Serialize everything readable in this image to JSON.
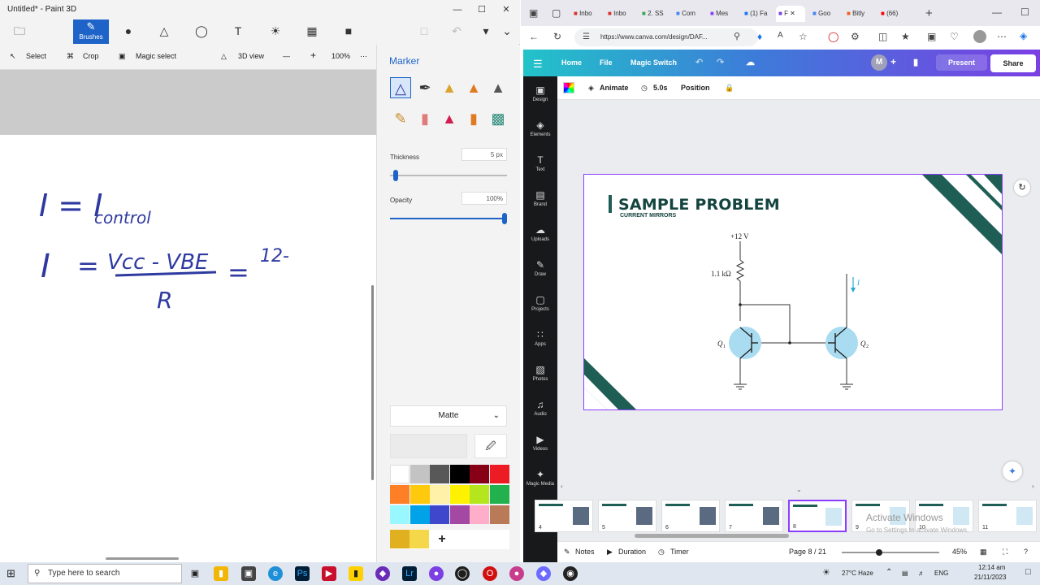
{
  "paint3d": {
    "title": "Untitled* - Paint 3D",
    "ribbon": {
      "brushes_label": "Brushes"
    },
    "toolbar": {
      "select": "Select",
      "crop": "Crop",
      "magic_select": "Magic select",
      "view3d": "3D view",
      "zoom": "100%"
    },
    "panel": {
      "title": "Marker",
      "thickness_label": "Thickness",
      "thickness_value": "5 px",
      "thickness_fraction": 0.05,
      "opacity_label": "Opacity",
      "opacity_value": "100%",
      "opacity_fraction": 1.0,
      "finish": "Matte",
      "add_color": "+",
      "palette": [
        "#ffffff",
        "#c3c3c3",
        "#585858",
        "#000000",
        "#880015",
        "#ed1c24",
        "#ff7f27",
        "#ffc90e",
        "#fff2a8",
        "#fff200",
        "#b5e61d",
        "#22b14c",
        "#99f7ff",
        "#00a2e8",
        "#3f48cc",
        "#a349a4",
        "#ffaec9",
        "#b97a57"
      ],
      "custom_colors": [
        "#e0b020",
        "#f5d84a"
      ]
    },
    "handwriting": {
      "line1a": "I = I",
      "line1b": "control",
      "line2a": "I",
      "line2b": "=",
      "numerator": "Vcc - VBE",
      "denominator": "R",
      "line2c": "=",
      "line2d": "12-"
    }
  },
  "browser": {
    "tabs": [
      "Inbo",
      "Inbo",
      "2. SS",
      "Com",
      "Mes",
      "(1) Fa",
      "F",
      "Goo",
      "Bitly",
      "(66)"
    ],
    "url": "https://www.canva.com/design/DAF...",
    "new_tab": "+"
  },
  "canva": {
    "nav": {
      "home": "Home",
      "file": "File",
      "magic_switch": "Magic Switch",
      "avatar": "M",
      "present": "Present",
      "share": "Share"
    },
    "sidebar": [
      {
        "icon": "▣",
        "label": "Design"
      },
      {
        "icon": "◈",
        "label": "Elements"
      },
      {
        "icon": "T",
        "label": "Text"
      },
      {
        "icon": "▤",
        "label": "Brand"
      },
      {
        "icon": "☁",
        "label": "Uploads"
      },
      {
        "icon": "✎",
        "label": "Draw"
      },
      {
        "icon": "▢",
        "label": "Projects"
      },
      {
        "icon": "∷",
        "label": "Apps"
      },
      {
        "icon": "▧",
        "label": "Photos"
      },
      {
        "icon": "♫",
        "label": "Audio"
      },
      {
        "icon": "▶",
        "label": "Videos"
      },
      {
        "icon": "✦",
        "label": "Magic Media"
      }
    ],
    "toolbar": {
      "animate": "Animate",
      "duration": "5.0s",
      "position": "Position"
    },
    "slide": {
      "title": "SAMPLE PROBLEM",
      "subtitle": "CURRENT MIRRORS",
      "circuit": {
        "vcc": "+12 V",
        "resistor": "1.1 kΩ",
        "q1": "Q",
        "q1_sub": "1",
        "q2": "Q",
        "q2_sub": "2",
        "current": "I"
      }
    },
    "thumbnails": [
      {
        "num": "4"
      },
      {
        "num": "5"
      },
      {
        "num": "6"
      },
      {
        "num": "7"
      },
      {
        "num": "8"
      },
      {
        "num": "9"
      },
      {
        "num": "10"
      },
      {
        "num": "11"
      }
    ],
    "bottom": {
      "notes": "Notes",
      "duration": "Duration",
      "timer": "Timer",
      "page": "Page 8 / 21",
      "zoom": "45%"
    },
    "watermark": {
      "line1": "Activate Windows",
      "line2": "Go to Settings to activate Windows."
    }
  },
  "taskbar": {
    "search_placeholder": "Type here to search",
    "weather": "27°C  Haze",
    "lang": "ENG",
    "time": "12:14 am",
    "date": "21/11/2023"
  }
}
